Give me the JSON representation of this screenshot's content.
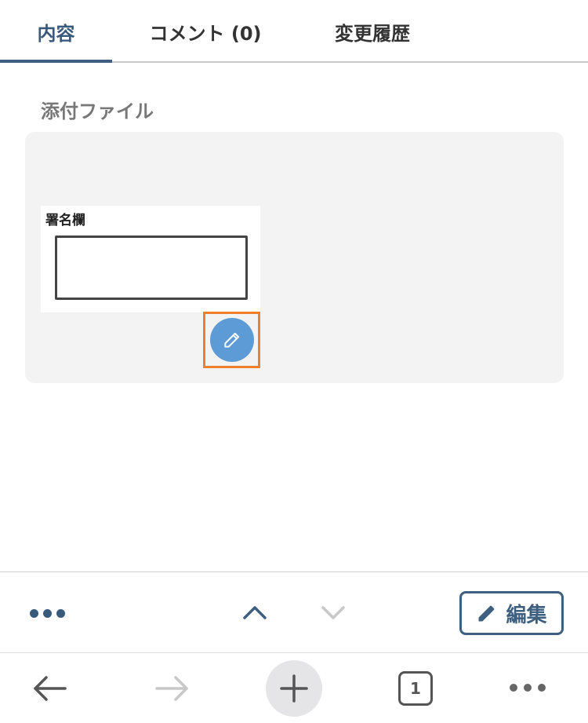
{
  "tabs": [
    {
      "label": "内容",
      "active": true
    },
    {
      "label": "コメント (0)",
      "active": false
    },
    {
      "label": "変更履歴",
      "active": false
    }
  ],
  "attachments": {
    "section_label": "添付ファイル",
    "thumbnail_title": "署名欄"
  },
  "action_bar": {
    "edit_label": "編集",
    "icons": [
      "more-horizontal-icon",
      "chevron-up-icon",
      "chevron-down-icon",
      "pencil-icon"
    ]
  },
  "browser_bar": {
    "tab_count": "1",
    "icons": [
      "back-arrow-icon",
      "forward-arrow-icon",
      "plus-icon",
      "tabs-icon",
      "more-icon"
    ]
  },
  "colors": {
    "accent": "#3e5f80",
    "highlight": "#ef7f2d",
    "edit_circle": "#5c9bd6"
  }
}
